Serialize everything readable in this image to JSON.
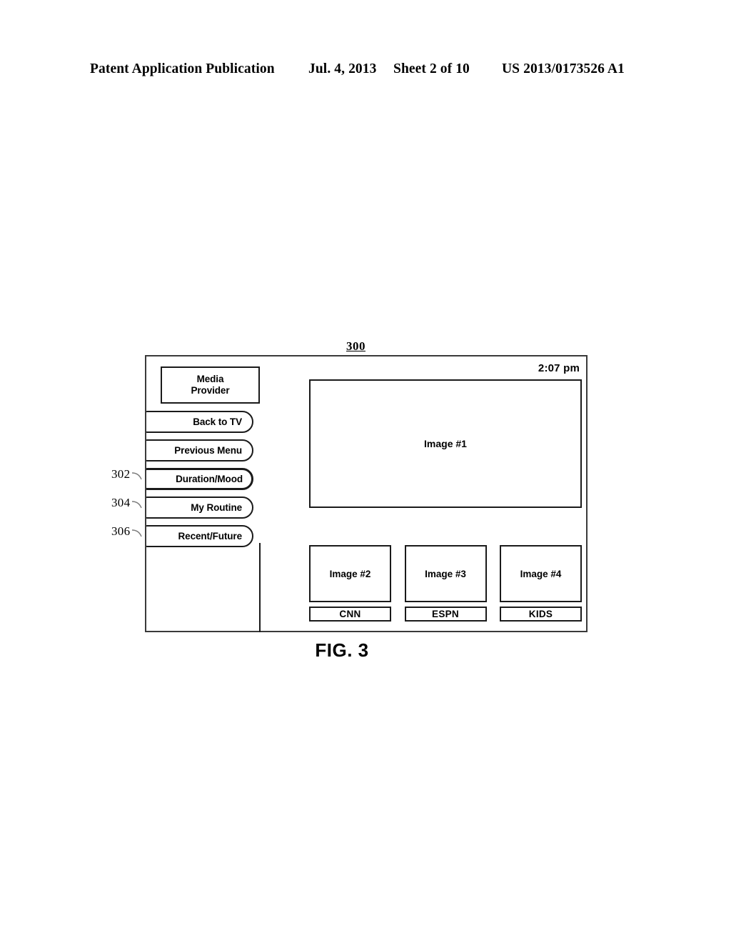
{
  "header": {
    "publication": "Patent Application Publication",
    "date": "Jul. 4, 2013",
    "sheet": "Sheet 2 of 10",
    "patent_number": "US 2013/0173526 A1"
  },
  "figure": {
    "caption": "FIG. 3",
    "reference_label": "300"
  },
  "screen": {
    "sidebar": {
      "provider": {
        "line1": "Media",
        "line2": "Provider"
      },
      "buttons": [
        {
          "label": "Back to TV",
          "selected": false,
          "callout": null
        },
        {
          "label": "Previous Menu",
          "selected": false,
          "callout": null
        },
        {
          "label": "Duration/Mood",
          "selected": true,
          "callout": "302"
        },
        {
          "label": "My Routine",
          "selected": false,
          "callout": "304"
        },
        {
          "label": "Recent/Future",
          "selected": false,
          "callout": "306"
        }
      ]
    },
    "content": {
      "clock": "2:07 pm",
      "main_image": "Image #1",
      "thumbnails": [
        {
          "image": "Image #2",
          "label": "CNN"
        },
        {
          "image": "Image #3",
          "label": "ESPN"
        },
        {
          "image": "Image #4",
          "label": "KIDS"
        }
      ]
    }
  },
  "callouts": [
    {
      "number": "302"
    },
    {
      "number": "304"
    },
    {
      "number": "306"
    }
  ],
  "colors": {
    "ink": "#1a1a1a",
    "frame": "#3a3a3a",
    "paper": "#ffffff"
  }
}
